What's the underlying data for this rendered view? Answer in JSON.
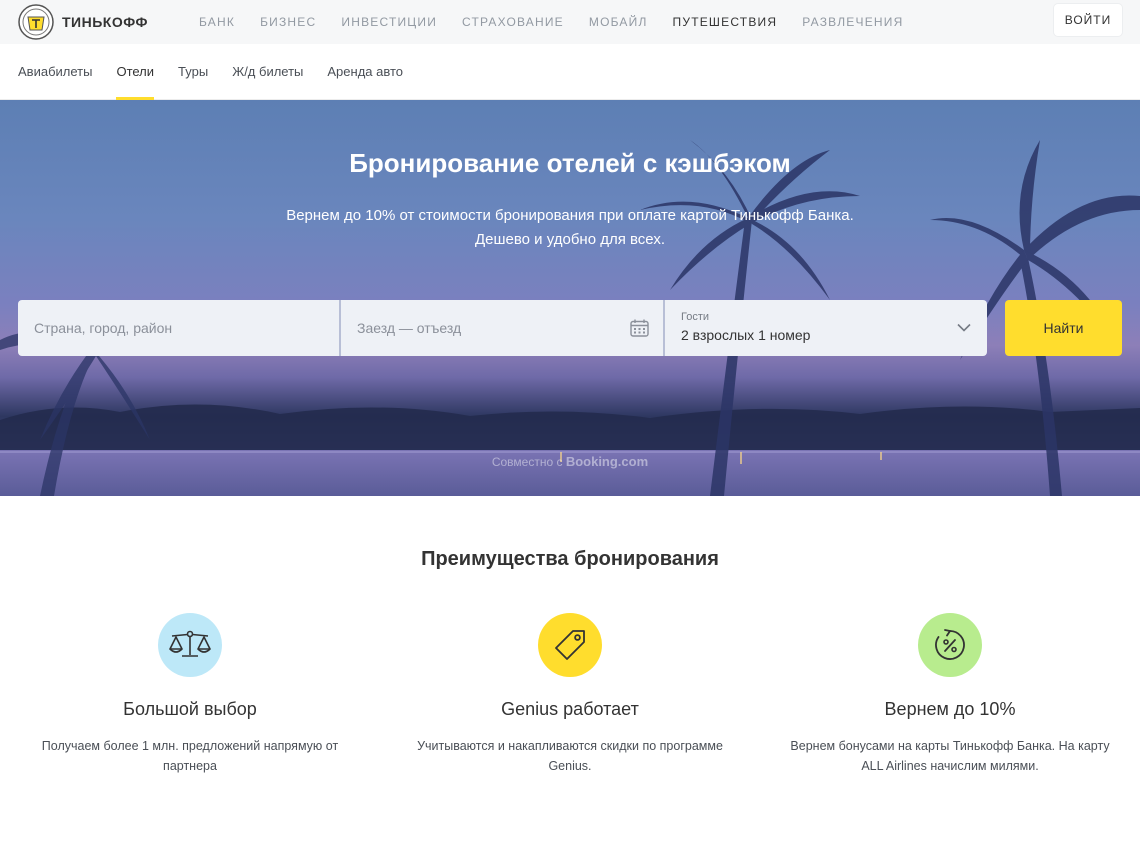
{
  "brand": {
    "name": "ТИНЬКОФФ"
  },
  "topnav": {
    "items": [
      "БАНК",
      "БИЗНЕС",
      "ИНВЕСТИЦИИ",
      "СТРАХОВАНИЕ",
      "МОБАЙЛ",
      "ПУТЕШЕСТВИЯ",
      "РАЗВЛЕЧЕНИЯ"
    ],
    "active": "ПУТЕШЕСТВИЯ",
    "login_label": "ВОЙТИ"
  },
  "subnav": {
    "items": [
      "Авиабилеты",
      "Отели",
      "Туры",
      "Ж/д билеты",
      "Аренда авто"
    ],
    "active": "Отели"
  },
  "hero": {
    "title": "Бронирование отелей с кэшбэком",
    "subtitle_line1": "Вернем до 10% от стоимости бронирования при оплате картой Тинькофф Банка.",
    "subtitle_line2": "Дешево и удобно для всех.",
    "partner_prefix": "Совместно с",
    "partner_name": "Booking.com"
  },
  "search": {
    "destination_placeholder": "Страна, город, район",
    "dates_placeholder": "Заезд — отъезд",
    "guests_label": "Гости",
    "guests_value": "2 взрослых 1 номер",
    "submit_label": "Найти"
  },
  "benefits": {
    "title": "Преимущества бронирования",
    "items": [
      {
        "title": "Большой выбор",
        "text": "Получаем более 1 млн. предложений напрямую от партнера",
        "icon": "scales-icon",
        "color": "#bde8f8"
      },
      {
        "title": "Genius работает",
        "text": "Учитываются и накапливаются скидки по программе Genius.",
        "icon": "tag-icon",
        "color": "#ffdd2d"
      },
      {
        "title": "Вернем до 10%",
        "text": "Вернем бонусами на карты Тинькофф Банка. На карту ALL Airlines начислим милями.",
        "icon": "percent-refresh-icon",
        "color": "#b8ec8e"
      }
    ]
  },
  "colors": {
    "accent": "#ffdd2d",
    "topbar_bg": "#f6f7f8"
  }
}
